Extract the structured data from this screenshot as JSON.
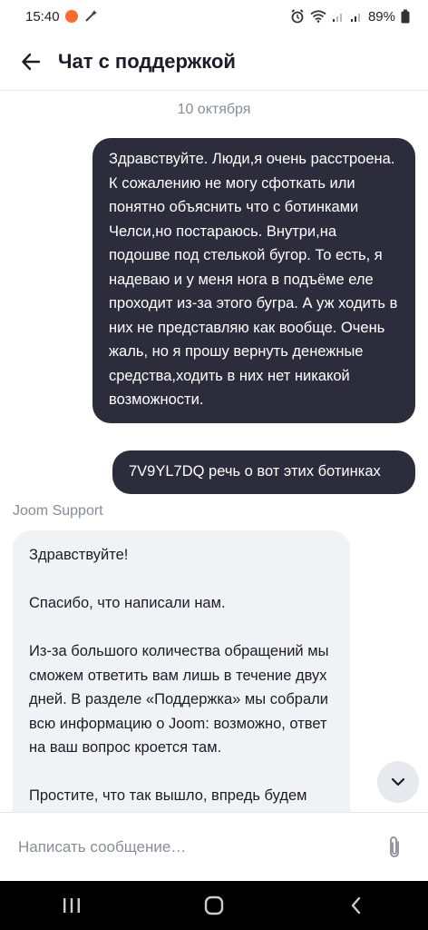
{
  "status_bar": {
    "time": "15:40",
    "battery": "89%"
  },
  "header": {
    "title": "Чат с поддержкой"
  },
  "chat": {
    "date": "10 октября",
    "outgoing": [
      "Здравствуйте. Люди,я очень расстроена. К сожалению не могу сфоткать или понятно объяснить что с ботинками Челси,но постараюсь. Внутри,на подошве под стелькой бугор. То есть, я надеваю и у меня нога в подъёме еле проходит из-за этого бугра. А уж ходить в них не представляю как вообще. Очень жаль, но я прошу вернуть денежные средства,ходить в них нет никакой возможности.",
      "7V9YL7DQ речь о вот этих ботинках"
    ],
    "incoming": {
      "sender": "Joom Support",
      "paragraphs": [
        "Здравствуйте!",
        "Спасибо, что написали нам.",
        "Из-за большого количества обращений мы сможем ответить вам лишь в течение двух дней. В разделе «Поддержка» мы собрали всю информацию о Joom: возможно, ответ на ваш вопрос кроется там.",
        "Простите, что так вышло, впредь будем стараться лучше."
      ]
    }
  },
  "composer": {
    "placeholder": "Написать сообщение…"
  },
  "colors": {
    "outgoing_bubble": "#2b2d3c",
    "incoming_bubble": "#f1f2f6",
    "muted_text": "#8a8c99"
  }
}
